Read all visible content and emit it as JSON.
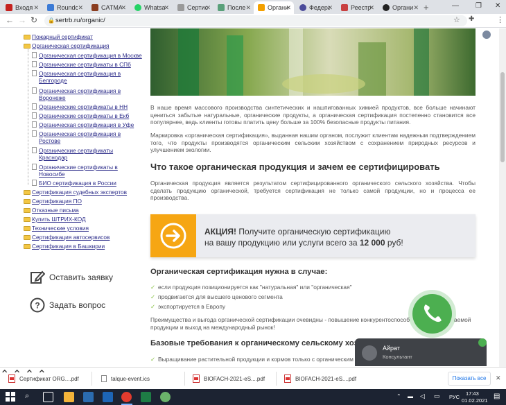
{
  "browser": {
    "tabs": [
      {
        "label": "Входя",
        "color": "#c5221f"
      },
      {
        "label": "Roundc",
        "color": "#3c7bd6"
      },
      {
        "label": "CATMA",
        "color": "#8b3d1f"
      },
      {
        "label": "Whatsa",
        "color": "#25d366"
      },
      {
        "label": "Сертис",
        "color": "#7a7a7a"
      },
      {
        "label": "После",
        "color": "#5aa07a"
      },
      {
        "label": "Органи",
        "color": "#f3a000"
      },
      {
        "label": "Федера",
        "color": "#4a4a9a"
      },
      {
        "label": "Реестр",
        "color": "#c94040"
      },
      {
        "label": "Органи",
        "color": "#222"
      }
    ],
    "active_tab": 6,
    "url": "sertrb.ru/organic/"
  },
  "sidebar": {
    "items_top": [
      {
        "label": "Пожарный сертификат",
        "type": "folder"
      },
      {
        "label": "Органическая сертификация",
        "type": "folder"
      }
    ],
    "sub_items": [
      {
        "label": "Органическая сертификация в Москве"
      },
      {
        "label": "Органические сертификаты в СПб"
      },
      {
        "label": "Органическая сертификация в",
        "label2": "Белгороде"
      },
      {
        "label": "Органическая сертификация в",
        "label2": "Воронеже"
      },
      {
        "label": "Органические сертификаты в НН"
      },
      {
        "label": "Органические сертификаты в Екб"
      },
      {
        "label": "Органическая сертификация в Уфе"
      },
      {
        "label": "Органическая сертификация в",
        "label2": "Ростове"
      },
      {
        "label": "Органические сертификаты",
        "label2": "Краснодар"
      },
      {
        "label": "Органические сертификаты в",
        "label2": "Новосибе"
      },
      {
        "label": "БИО сертификация в России"
      }
    ],
    "items_bottom": [
      {
        "label": "Сертификация судебных экспертов"
      },
      {
        "label": "Сертификация ПО"
      },
      {
        "label": "Отказные письма"
      },
      {
        "label": "Купить ШТРИХ-КОД"
      },
      {
        "label": "Технические условия"
      },
      {
        "label": "Сертификация автосервисов"
      },
      {
        "label": "Сертификация в Башкирии"
      }
    ],
    "cta_order": "Оставить заявку",
    "cta_ask": "Задать вопрос"
  },
  "content": {
    "p1": "В наше время массового производства синтетических и нашпигованных химией продуктов, все больше начинают цениться забытые натуральные, органические продукты, а органическая сертификация постепенно становится все популярнее, ведь клиенты готовы платить цену больше за 100% безопасные продукты питания.",
    "p2": "Маркировка «органическая сертификация», выданная нашим органом, послужит клиентам надежным подтверждением того, что продукты производятся органическим сельским хозяйством с сохранением природных ресурсов и улучшением экологии.",
    "h2": "Что такое органическая продукция и зачем ее сертифицировать",
    "p3": "Органическая продукция является результатом сертифицированного органического сельского хозяйства. Чтобы сделать продукцию органической, требуется сертификация не только самой продукции, но и процесса ее производства.",
    "promo": {
      "bold": "АКЦИЯ!",
      "line1": " Получите органическую сертификацию",
      "line2": "на вашу продукцию или услуги всего за ",
      "price": "12 000",
      "currency": " руб!"
    },
    "h3a": "Органическая сертификация нужна в случае:",
    "checks": [
      "если продукция позиционируется как \"натуральная\" или \"органическая\"",
      "продвигается для высшего ценового сегмента",
      "экспортируется в Европу"
    ],
    "p4": "Преимущества и выгода органической сертификации очевидны - повышение конкурентоспособ",
    "p4b": "аемой",
    "p4c": "продукции и выход на международный рынок!",
    "h3b": "Базовые требования к органическому сельскому хозяй",
    "check_last": "Выращивание растительной продукции и кормов только с органическим"
  },
  "chat": {
    "name": "Айрат",
    "role": "Консультант"
  },
  "downloads": {
    "files": [
      "Сертификат ORG....pdf",
      "talque-event.ics",
      "BIOFACH-2021-eS....pdf",
      "BIOFACH-2021-eS....pdf"
    ],
    "show_all": "Показать все"
  },
  "taskbar": {
    "lang": "РУС",
    "time": "17:43",
    "date": "01.02.2021"
  }
}
